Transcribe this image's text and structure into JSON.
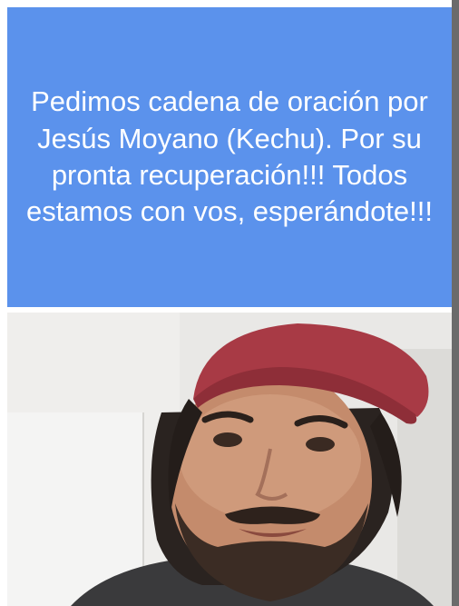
{
  "post": {
    "message": "Pedimos cadena de oración por\nJesús Moyano (Kechu). Por su\npronta recuperación!!! Todos\nestamos con vos, esperándote!!!"
  },
  "colors": {
    "banner_background": "#5b92ec",
    "banner_text": "#ffffff",
    "cap": "#a83a45"
  }
}
